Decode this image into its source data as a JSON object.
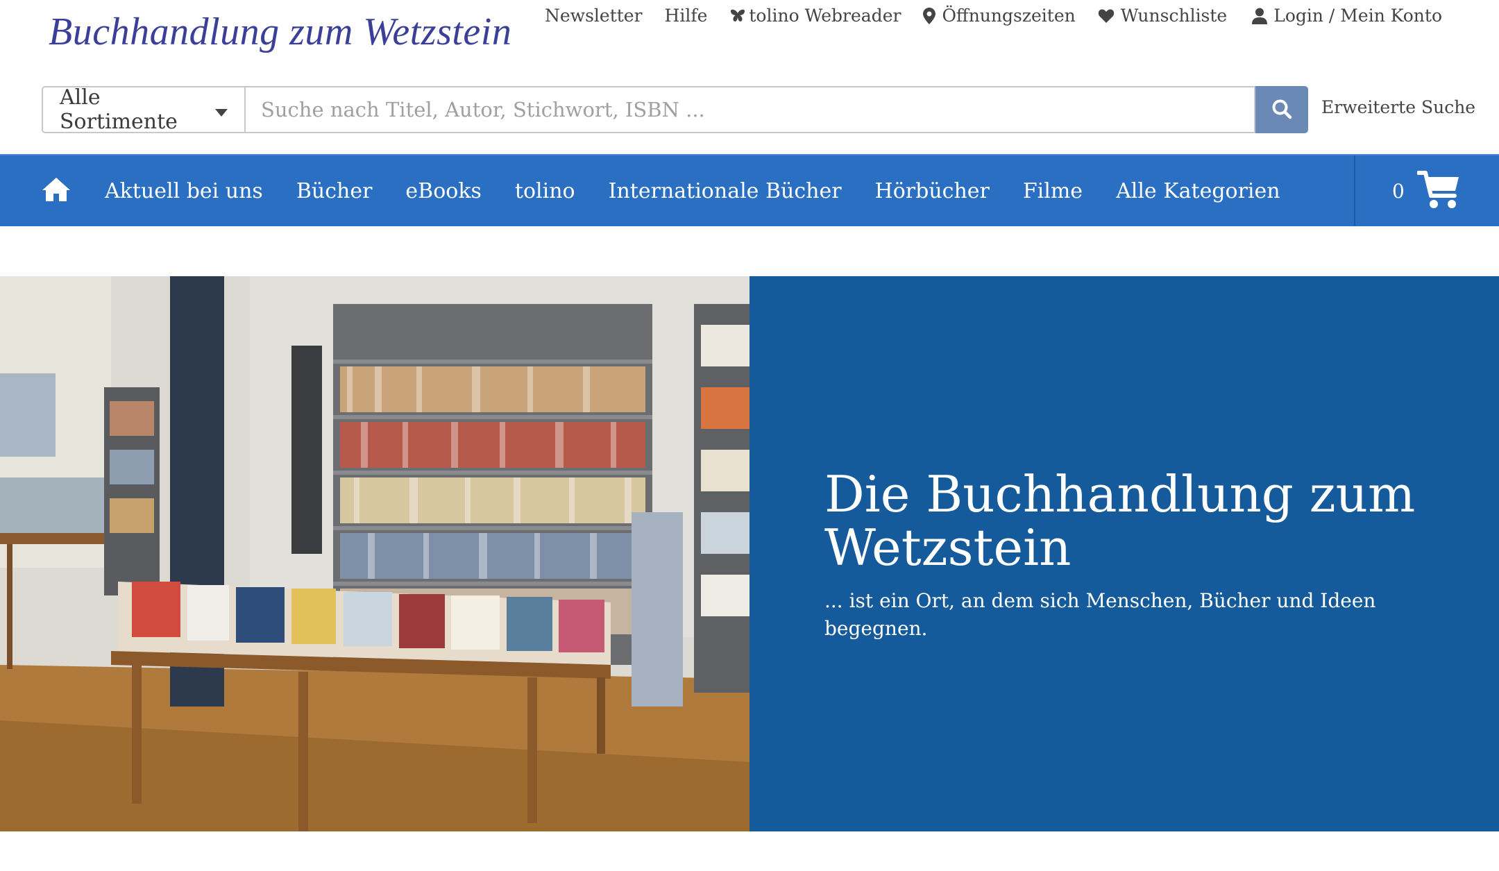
{
  "header": {
    "logo_text": "Buchhandlung zum Wetzstein",
    "service_nav": [
      {
        "label": "Newsletter",
        "icon": ""
      },
      {
        "label": "Hilfe",
        "icon": ""
      },
      {
        "label": "tolino Webreader",
        "icon": "butterfly-icon"
      },
      {
        "label": "Öffnungszeiten",
        "icon": "map-pin-icon"
      },
      {
        "label": "Wunschliste",
        "icon": "heart-icon"
      },
      {
        "label": "Login / Mein Konto",
        "icon": "user-icon"
      }
    ]
  },
  "search": {
    "scope_selected": "Alle Sortimente",
    "placeholder": "Suche nach Titel, Autor, Stichwort, ISBN ...",
    "value": "",
    "advanced_label": "Erweiterte Suche"
  },
  "mainnav": {
    "items": [
      {
        "label": "Aktuell bei uns"
      },
      {
        "label": "Bücher"
      },
      {
        "label": "eBooks"
      },
      {
        "label": "tolino"
      },
      {
        "label": "Internationale Bücher"
      },
      {
        "label": "Hörbücher"
      },
      {
        "label": "Filme"
      },
      {
        "label": "Alle Kategorien"
      }
    ],
    "cart_count": "0"
  },
  "hero": {
    "title": "Die Buchhandlung zum Wetzstein",
    "subtitle": "... ist ein Ort, an dem sich Menschen, Bücher und Ideen begeg­nen."
  },
  "colors": {
    "nav_blue": "#2a6fc2",
    "hero_blue": "#155a9a",
    "search_button": "#6a89b4",
    "logo": "#3c3f99"
  }
}
